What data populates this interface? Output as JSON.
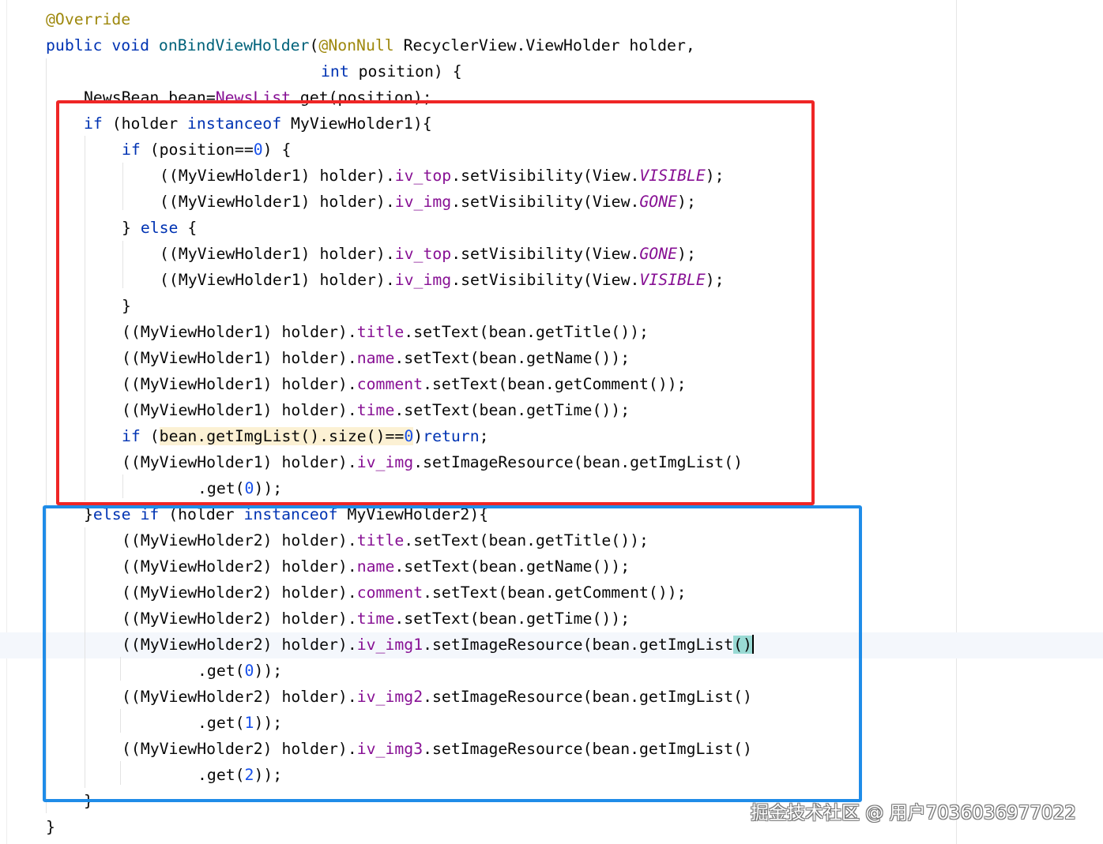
{
  "colors": {
    "keyword": "#0033b3",
    "field": "#871094",
    "number": "#1750eb",
    "annotation": "#9e880d",
    "method": "#00627a",
    "red_box": "#ef2626",
    "blue_box": "#1f8ce8"
  },
  "tokens": {
    "override": "@Override",
    "public_void": "public void ",
    "method_name": "onBindViewHolder",
    "paren_open": "(",
    "nonnull": "@NonNull",
    "param1": " RecyclerView.ViewHolder holder,",
    "int_kw": "int",
    "param2": " position) {",
    "bean_decl_a": "NewsBean bean=",
    "news_list": "NewsList",
    "bean_decl_b": ".get(position);",
    "if_kw": "if",
    "instanceof_kw": "instanceof",
    "else_kw": "else",
    "return_kw": "return",
    "holder1_open": " (holder ",
    "holder1_type": " MyViewHolder1){",
    "holder2_type": " MyViewHolder2){",
    "pos_check_a": " (position==",
    "zero": "0",
    "one": "1",
    "two": "2",
    "pos_check_b": ") {",
    "cast1": "((MyViewHolder1) holder).",
    "cast2": "((MyViewHolder2) holder).",
    "iv_top": "iv_top",
    "iv_img": "iv_img",
    "iv_img1": "iv_img1",
    "iv_img2": "iv_img2",
    "iv_img3": "iv_img3",
    "title": "title",
    "name": "name",
    "comment": "comment",
    "time": "time",
    "set_vis": ".setVisibility(View.",
    "visible": "VISIBLE",
    "gone": "GONE",
    "end_paren": ");",
    "close_brace": "}",
    "else_open_a": "} ",
    "else_open_b": " {",
    "set_title": ".setText(bean.getTitle());",
    "set_name": ".setText(bean.getName());",
    "set_comment": ".setText(bean.getComment());",
    "set_time": ".setText(bean.getTime());",
    "if_space": " (",
    "size_check_a": "bean.getImgList().size()==",
    "paren_close": ")",
    "semicolon": ";",
    "set_img": ".setImageResource(bean.getImgList()",
    "set_img_short": ".setImageResource(bean.getImgList",
    "parens": "()",
    "get_open": ".get(",
    "get_close": "));",
    "else_if_brace": "}",
    "else_if_space": " (holder "
  },
  "watermark": "掘金技术社区 @ 用户7036036977022"
}
